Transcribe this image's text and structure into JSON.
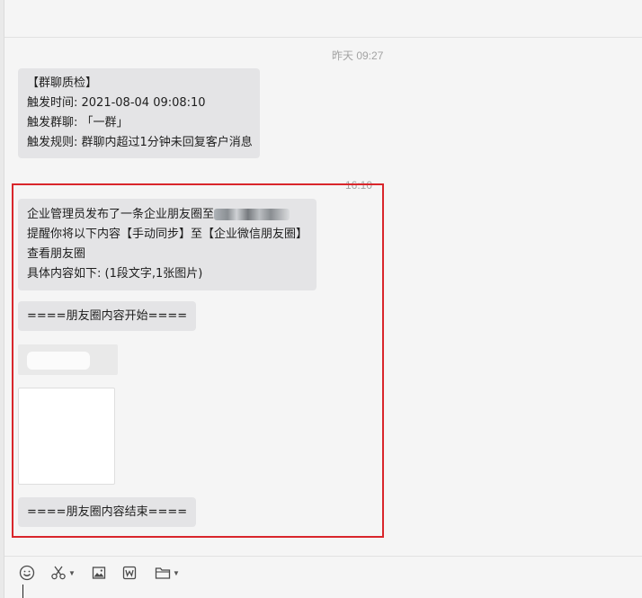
{
  "messages": {
    "ts1": "昨天 09:27",
    "msg1": {
      "line1": "【群聊质检】",
      "line2": "触发时间: 2021-08-04 09:08:10",
      "line3": "触发群聊: 「一群」",
      "line4": "触发规则: 群聊内超过1分钟未回复客户消息"
    },
    "ts2": "16:10",
    "msg2": {
      "line1": "企业管理员发布了一条企业朋友圈至",
      "line2": "提醒你将以下内容【手动同步】至【企业微信朋友圈】",
      "line3": "查看朋友圈",
      "line4": "具体内容如下: (1段文字,1张图片)"
    },
    "start_marker": "====朋友圈内容开始====",
    "end_marker": "====朋友圈内容结束===="
  },
  "toolbar": {
    "items": [
      "emoji-icon",
      "scissors-icon",
      "image-icon",
      "word-doc-icon",
      "folder-icon"
    ]
  },
  "colors": {
    "highlight_border": "#d9262b",
    "bubble": "#e4e4e6",
    "timestamp": "#a3a3a3"
  }
}
